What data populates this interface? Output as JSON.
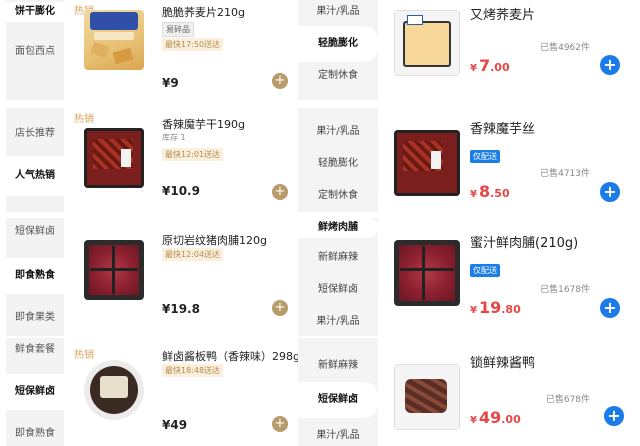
{
  "panels": [
    {
      "left_categories": [
        {
          "label": "饼干膨化",
          "active": true
        },
        {
          "label": "面包西点",
          "active": false
        }
      ],
      "hot_label": "热销",
      "left_product": {
        "name": "脆脆荞麦片210g",
        "sub": "",
        "tag": "易碎品",
        "tag2": "最快17:50送达",
        "price": "¥9"
      },
      "right_categories": [
        {
          "label": "果汁/乳品",
          "active": false
        },
        {
          "label": "轻脆膨化",
          "active": true
        },
        {
          "label": "定制休食",
          "active": false
        }
      ],
      "right_product": {
        "name": "又烤荞麦片",
        "badge": "",
        "sold": "已售4962件",
        "price_symbol": "¥",
        "price_int": "7",
        "price_dec": ".00"
      },
      "add_left": "+",
      "add_right": "+"
    },
    {
      "left_categories": [
        {
          "label": "店长推荐",
          "active": false
        },
        {
          "label": "人气热销",
          "active": true
        }
      ],
      "hot_label": "热销",
      "left_product": {
        "name": "香辣魔芋干190g",
        "sub": "库存 1",
        "tag": "",
        "tag2": "最快12:01送达",
        "price": "¥10.9"
      },
      "right_categories": [
        {
          "label": "果汁/乳品",
          "active": false
        },
        {
          "label": "轻脆膨化",
          "active": false
        },
        {
          "label": "定制休食",
          "active": false
        }
      ],
      "right_product": {
        "name": "香辣魔芋丝",
        "badge": "仅配送",
        "sold": "已售4713件",
        "price_symbol": "¥",
        "price_int": "8",
        "price_dec": ".50"
      },
      "add_left": "+",
      "add_right": "+"
    },
    {
      "left_categories": [
        {
          "label": "短保鲜卤",
          "active": false
        },
        {
          "label": "即食熟食",
          "active": true
        },
        {
          "label": "即食果类",
          "active": false
        }
      ],
      "hot_label": "",
      "left_product": {
        "name": "原切岩纹猪肉脯120g",
        "sub": "",
        "tag": "",
        "tag2": "最快12:04送达",
        "price": "¥19.8"
      },
      "right_categories": [
        {
          "label": "鲜烤肉脯",
          "active": true
        },
        {
          "label": "新鲜麻辣",
          "active": false
        },
        {
          "label": "短保鲜卤",
          "active": false
        },
        {
          "label": "果汁/乳品",
          "active": false
        }
      ],
      "right_product": {
        "name": "蜜汁鲜肉脯(210g)",
        "badge": "仅配送",
        "sold": "已售1678件",
        "price_symbol": "¥",
        "price_int": "19",
        "price_dec": ".80"
      },
      "add_left": "+",
      "add_right": "+"
    },
    {
      "left_categories": [
        {
          "label": "鲜食套餐",
          "active": false
        },
        {
          "label": "短保鲜卤",
          "active": true
        },
        {
          "label": "即食熟食",
          "active": false
        }
      ],
      "hot_label": "热销",
      "left_product": {
        "name": "鲜卤酱板鸭（香辣味）298g",
        "sub": "",
        "tag": "",
        "tag2": "最快18:48送达",
        "price": "¥49"
      },
      "right_categories": [
        {
          "label": "新鲜麻辣",
          "active": false
        },
        {
          "label": "短保鲜卤",
          "active": true
        },
        {
          "label": "果汁/乳品",
          "active": false
        }
      ],
      "right_product": {
        "name": "锁鲜辣酱鸭",
        "badge": "",
        "sold": "已售678件",
        "price_symbol": "¥",
        "price_int": "49",
        "price_dec": ".00"
      },
      "add_left": "+",
      "add_right": "+"
    }
  ]
}
